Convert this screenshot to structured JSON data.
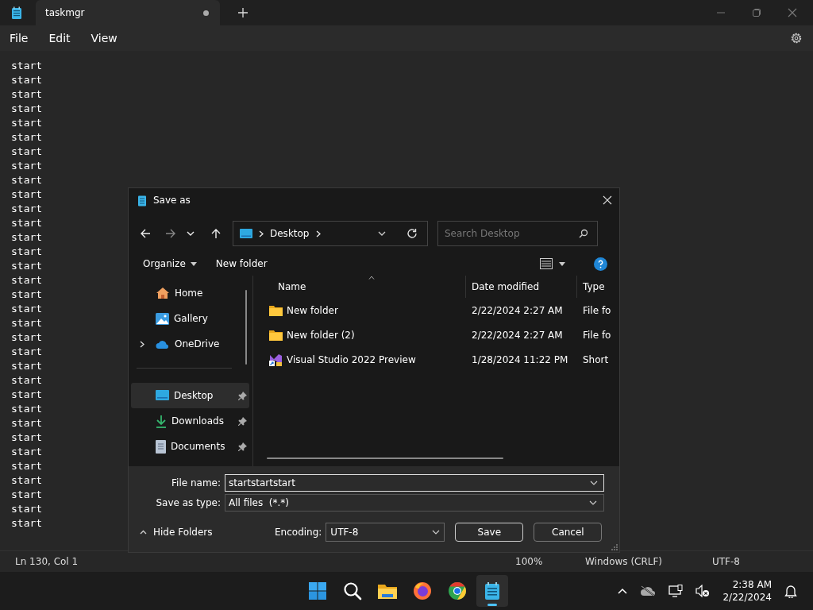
{
  "app": {
    "tab_title": "taskmgr",
    "unsaved": true
  },
  "menu": [
    "File",
    "Edit",
    "View"
  ],
  "editor": {
    "lines": [
      "start",
      "start",
      "start",
      "start",
      "start",
      "start",
      "start",
      "start",
      "start",
      "start",
      "start",
      "start",
      "start",
      "start",
      "start",
      "start",
      "start",
      "start",
      "start",
      "start",
      "start",
      "start",
      "start",
      "start",
      "start",
      "start",
      "start",
      "start",
      "start",
      "start",
      "start",
      "start",
      "start"
    ]
  },
  "status_bar": {
    "position": "Ln 130, Col 1",
    "zoom": "100%",
    "line_ending": "Windows (CRLF)",
    "encoding": "UTF-8"
  },
  "dialog": {
    "title": "Save as",
    "breadcrumb": [
      "Desktop"
    ],
    "search": {
      "placeholder": "Search Desktop"
    },
    "toolbar": [
      "Organize",
      "New folder"
    ],
    "nav_top": [
      {
        "label": "Home",
        "kind": "home",
        "expandable": false
      },
      {
        "label": "Gallery",
        "kind": "gallery",
        "expandable": false
      },
      {
        "label": "OneDrive",
        "kind": "cloud",
        "expandable": true
      }
    ],
    "nav_pinned": [
      {
        "label": "Desktop",
        "kind": "desktop",
        "selected": true,
        "pinned": true
      },
      {
        "label": "Downloads",
        "kind": "download",
        "selected": false,
        "pinned": true
      },
      {
        "label": "Documents",
        "kind": "document",
        "selected": false,
        "pinned": true
      }
    ],
    "columns": [
      "Name",
      "Date modified",
      "Type"
    ],
    "files": [
      {
        "name": "New folder",
        "date": "2/22/2024 2:27 AM",
        "type": "File fo",
        "kind": "folder"
      },
      {
        "name": "New folder (2)",
        "date": "2/22/2024 2:27 AM",
        "type": "File fo",
        "kind": "folder"
      },
      {
        "name": "Visual Studio 2022 Preview",
        "date": "1/28/2024 11:22 PM",
        "type": "Short",
        "kind": "shortcut"
      }
    ],
    "file_name_label": "File name:",
    "file_name": "startstartstart",
    "save_type_label": "Save as type:",
    "save_type": "All files  (*.*)",
    "hide_folders": "Hide Folders",
    "encoding_label": "Encoding:",
    "encoding": "UTF-8",
    "buttons": [
      "Save",
      "Cancel"
    ]
  },
  "taskbar": {
    "apps": [
      {
        "kind": "start",
        "active": false
      },
      {
        "kind": "search",
        "active": false
      },
      {
        "kind": "folder",
        "active": false
      },
      {
        "kind": "firefox",
        "active": false
      },
      {
        "kind": "chrome",
        "active": false
      },
      {
        "kind": "notepad",
        "active": true
      }
    ],
    "time": "2:38 AM",
    "date": "2/22/2024"
  }
}
